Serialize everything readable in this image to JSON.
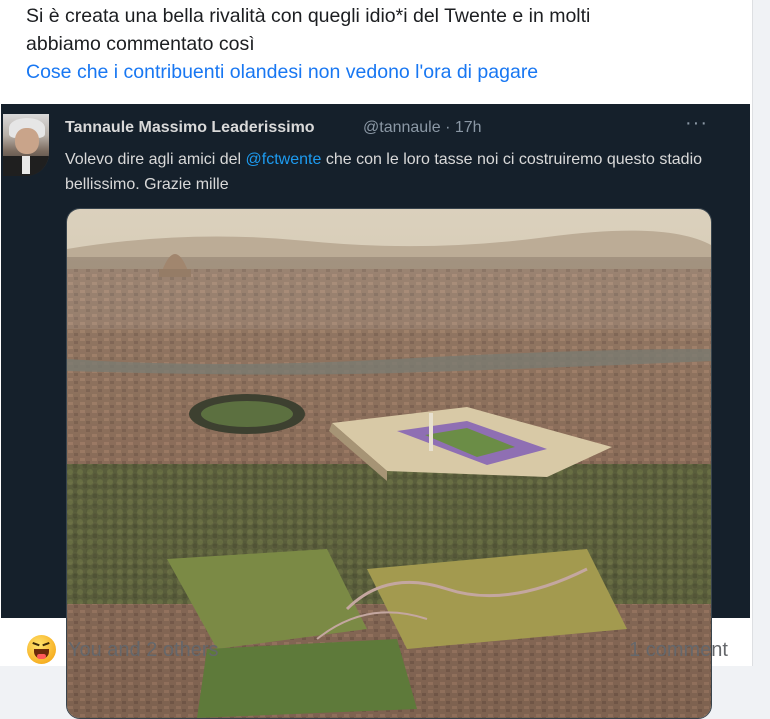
{
  "post": {
    "text_line1": "Si è creata una bella rivalità con quegli idio*i del Twente e in molti",
    "text_line2": "abbiamo commentato così",
    "link_text": "Cose che i contribuenti olandesi non vedono l'ora di pagare"
  },
  "tweet": {
    "author_name": "Tannaule Massimo Leaderissimo",
    "handle_time": "@tannaule · 17h",
    "more": "···",
    "body_before": "Volevo dire agli amici del ",
    "mention": "@fctwente",
    "body_after": " che con le loro tasse noi ci costruiremo questo stadio bellissimo. Grazie mille"
  },
  "footer": {
    "reaction_icon": "laughing-emoji-icon",
    "reactions_text": "You and 2 others",
    "comments_text": "1 comment"
  },
  "colors": {
    "link": "#1877f2",
    "tweet_bg": "#15202b",
    "mention": "#1d9bf0",
    "muted": "#65676b"
  }
}
